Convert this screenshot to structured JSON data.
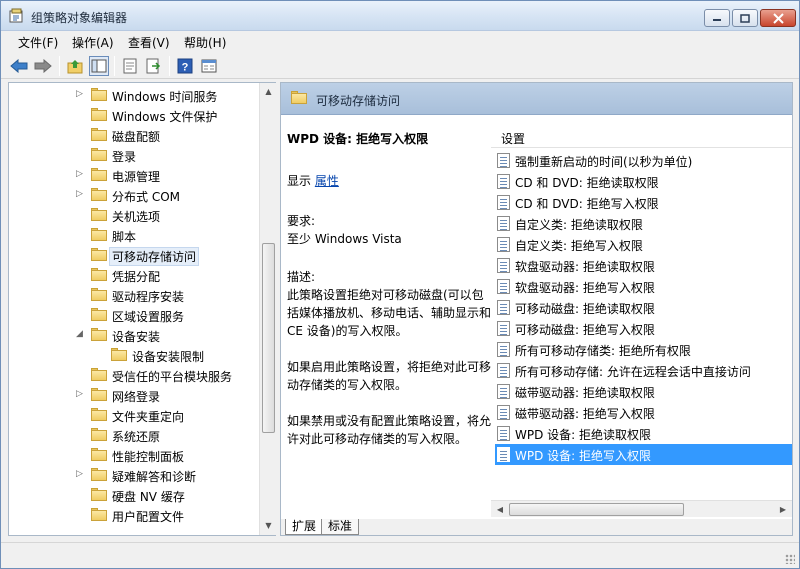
{
  "window": {
    "title": "组策略对象编辑器"
  },
  "menubar": [
    "文件(F)",
    "操作(A)",
    "查看(V)",
    "帮助(H)"
  ],
  "toolbar": {
    "icons": [
      "back-arrow-icon",
      "forward-arrow-icon",
      "up-folder-icon",
      "show-hide-tree-icon",
      "properties-icon",
      "export-list-icon",
      "help-icon",
      "view-icon"
    ]
  },
  "tree": {
    "items": [
      {
        "label": "Windows 时间服务",
        "expander": true
      },
      {
        "label": "Windows 文件保护",
        "expander": false
      },
      {
        "label": "磁盘配额",
        "expander": false
      },
      {
        "label": "登录",
        "expander": false
      },
      {
        "label": "电源管理",
        "expander": true
      },
      {
        "label": "分布式 COM",
        "expander": true
      },
      {
        "label": "关机选项",
        "expander": false
      },
      {
        "label": "脚本",
        "expander": false
      },
      {
        "label": "可移动存储访问",
        "expander": false,
        "selected": true
      },
      {
        "label": "凭据分配",
        "expander": false
      },
      {
        "label": "驱动程序安装",
        "expander": false
      },
      {
        "label": "区域设置服务",
        "expander": false
      },
      {
        "label": "设备安装",
        "expander": "open"
      },
      {
        "label": "设备安装限制",
        "expander": false,
        "child": true
      },
      {
        "label": "受信任的平台模块服务",
        "expander": false
      },
      {
        "label": "网络登录",
        "expander": true
      },
      {
        "label": "文件夹重定向",
        "expander": false
      },
      {
        "label": "系统还原",
        "expander": false
      },
      {
        "label": "性能控制面板",
        "expander": false
      },
      {
        "label": "疑难解答和诊断",
        "expander": true
      },
      {
        "label": "硬盘 NV 缓存",
        "expander": false
      },
      {
        "label": "用户配置文件",
        "expander": false
      }
    ]
  },
  "right_pane": {
    "folder_title": "可移动存储访问",
    "description": {
      "heading": "WPD 设备: 拒绝写入权限",
      "show_text": "显示",
      "properties_link": "属性",
      "requirements_label": "要求:",
      "requirements_value": "至少 Windows Vista",
      "desc_label": "描述:",
      "desc_text": "此策略设置拒绝对可移动磁盘(可以包括媒体播放机、移动电话、辅助显示和 CE 设备)的写入权限。",
      "if_enabled": "如果启用此策略设置，将拒绝对此可移动存储类的写入权限。",
      "if_disabled": "如果禁用或没有配置此策略设置，将允许对此可移动存储类的写入权限。"
    },
    "list_header": "设置",
    "settings": [
      "强制重新启动的时间(以秒为单位)",
      "CD 和 DVD: 拒绝读取权限",
      "CD 和 DVD: 拒绝写入权限",
      "自定义类: 拒绝读取权限",
      "自定义类: 拒绝写入权限",
      "软盘驱动器: 拒绝读取权限",
      "软盘驱动器: 拒绝写入权限",
      "可移动磁盘: 拒绝读取权限",
      "可移动磁盘: 拒绝写入权限",
      "所有可移动存储类: 拒绝所有权限",
      "所有可移动存储: 允许在远程会话中直接访问",
      "磁带驱动器: 拒绝读取权限",
      "磁带驱动器: 拒绝写入权限",
      "WPD 设备: 拒绝读取权限",
      "WPD 设备: 拒绝写入权限"
    ],
    "selected_setting_index": 14,
    "tabs": [
      "扩展",
      "标准"
    ],
    "active_tab_index": 0
  }
}
